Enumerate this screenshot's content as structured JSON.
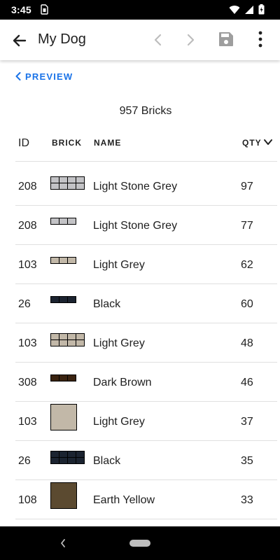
{
  "status_bar": {
    "time": "3:45",
    "icons": [
      "sim-icon",
      "wifi-icon",
      "signal-icon",
      "battery-icon"
    ]
  },
  "app_bar": {
    "title": "My Dog",
    "actions": [
      "back-icon",
      "previous-icon",
      "next-icon",
      "save-icon",
      "more-vert-icon"
    ]
  },
  "preview_label": "PREVIEW",
  "brick_count": "957 Bricks",
  "table": {
    "headers": {
      "id": "ID",
      "brick": "BRICK",
      "name": "NAME",
      "qty": "QTY"
    },
    "rows": [
      {
        "id": "208",
        "name": "Light Stone Grey",
        "qty": "97",
        "color": "#c3c3c6",
        "pattern": "2x4"
      },
      {
        "id": "208",
        "name": "Light Stone Grey",
        "qty": "77",
        "color": "#c3c3c6",
        "pattern": "1x3"
      },
      {
        "id": "103",
        "name": "Light Grey",
        "qty": "62",
        "color": "#c2b8a8",
        "pattern": "1x3"
      },
      {
        "id": "26",
        "name": "Black",
        "qty": "60",
        "color": "#1b2330",
        "pattern": "1x3"
      },
      {
        "id": "103",
        "name": "Light Grey",
        "qty": "48",
        "color": "#c2b8a8",
        "pattern": "2x4"
      },
      {
        "id": "308",
        "name": "Dark Brown",
        "qty": "46",
        "color": "#3a2310",
        "pattern": "1x3"
      },
      {
        "id": "103",
        "name": "Light Grey",
        "qty": "37",
        "color": "#c2b8a8",
        "pattern": "big"
      },
      {
        "id": "26",
        "name": "Black",
        "qty": "35",
        "color": "#1b2330",
        "pattern": "2x4"
      },
      {
        "id": "108",
        "name": "Earth Yellow",
        "qty": "33",
        "color": "#5b4a30",
        "pattern": "big"
      }
    ]
  },
  "colors": {
    "accent": "#1a73e8",
    "divider": "#e0e0e0"
  }
}
